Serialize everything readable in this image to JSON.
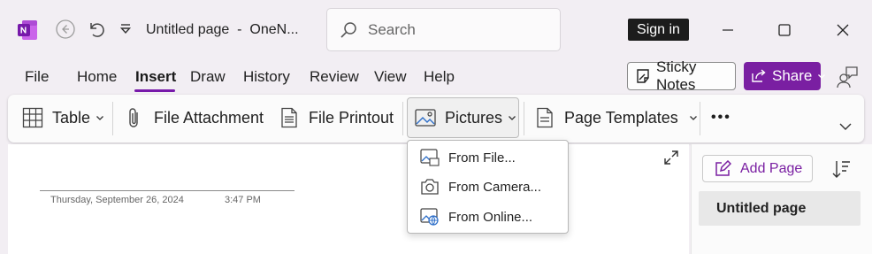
{
  "titlebar": {
    "app_icon": "onenote-logo",
    "doc_title": "Untitled page  -  OneN...",
    "search_placeholder": "Search",
    "signin_label": "Sign in"
  },
  "menu": {
    "tabs": [
      "File",
      "Home",
      "Insert",
      "Draw",
      "History",
      "Review",
      "View",
      "Help"
    ],
    "active_tab": "Insert",
    "sticky_notes_label": "Sticky Notes",
    "share_label": "Share"
  },
  "ribbon": {
    "table_label": "Table",
    "file_attachment_label": "File Attachment",
    "file_printout_label": "File Printout",
    "pictures_label": "Pictures",
    "page_templates_label": "Page Templates",
    "more_label": "•••"
  },
  "pictures_menu": {
    "items": [
      "From File...",
      "From Camera...",
      "From Online..."
    ]
  },
  "page": {
    "date": "Thursday, September 26, 2024",
    "time": "3:47 PM"
  },
  "sidepanel": {
    "add_page_label": "Add Page",
    "pages": [
      "Untitled page"
    ]
  },
  "colors": {
    "accent": "#7719aa",
    "share_bg": "#7a1fa2",
    "background": "#f2eef3"
  }
}
